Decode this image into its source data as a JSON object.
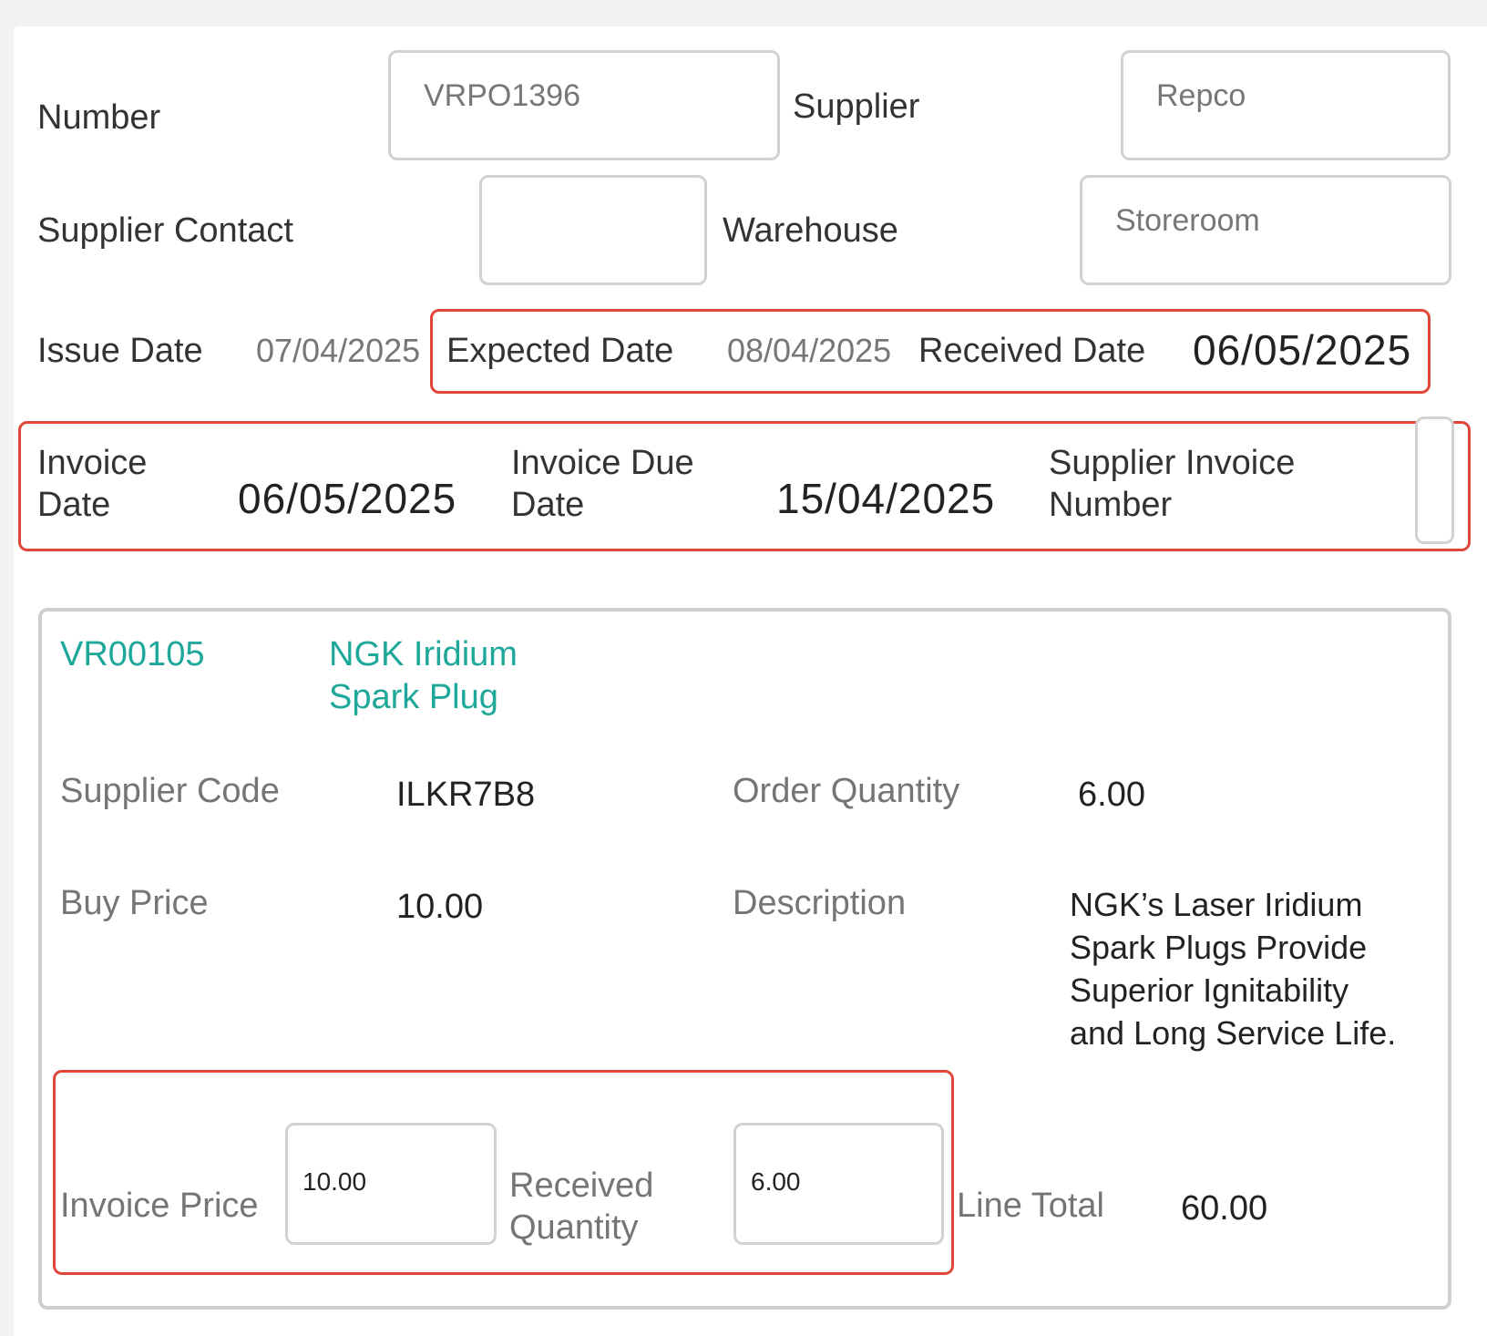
{
  "header": {
    "number_label": "Number",
    "number_value": "VRPO1396",
    "supplier_label": "Supplier",
    "supplier_value": "Repco",
    "supplier_contact_label": "Supplier Contact",
    "supplier_contact_value": "",
    "warehouse_label": "Warehouse",
    "warehouse_value": "Storeroom"
  },
  "dates": {
    "issue_label": "Issue Date",
    "issue_value": "07/04/2025",
    "expected_label": "Expected Date",
    "expected_value": "08/04/2025",
    "received_label": "Received Date",
    "received_value": "06/05/2025"
  },
  "invoice": {
    "date_label_1": "Invoice",
    "date_label_2": "Date",
    "date_value": "06/05/2025",
    "due_label_1": "Invoice Due",
    "due_label_2": "Date",
    "due_value": "15/04/2025",
    "supplier_invoice_label_1": "Supplier Invoice",
    "supplier_invoice_label_2": "Number",
    "supplier_invoice_value": ""
  },
  "line_item": {
    "code": "VR00105",
    "name_line_1": "NGK Iridium",
    "name_line_2": "Spark Plug",
    "supplier_code_label": "Supplier Code",
    "supplier_code_value": "ILKR7B8",
    "order_qty_label": "Order Quantity",
    "order_qty_value": "6.00",
    "buy_price_label": "Buy Price",
    "buy_price_value": "10.00",
    "description_label": "Description",
    "description_value": "NGK’s Laser Iridium Spark Plugs Provide Superior Ignitability and Long Service Life.",
    "invoice_price_label": "Invoice Price",
    "invoice_price_value": "10.00",
    "received_qty_label_1": "Received",
    "received_qty_label_2": "Quantity",
    "received_qty_value": "6.00",
    "line_total_label": "Line Total",
    "line_total_value": "60.00"
  },
  "colors": {
    "accent_teal": "#1ea89a",
    "highlight_red": "#e0463a",
    "field_border": "#d2d2d2"
  }
}
